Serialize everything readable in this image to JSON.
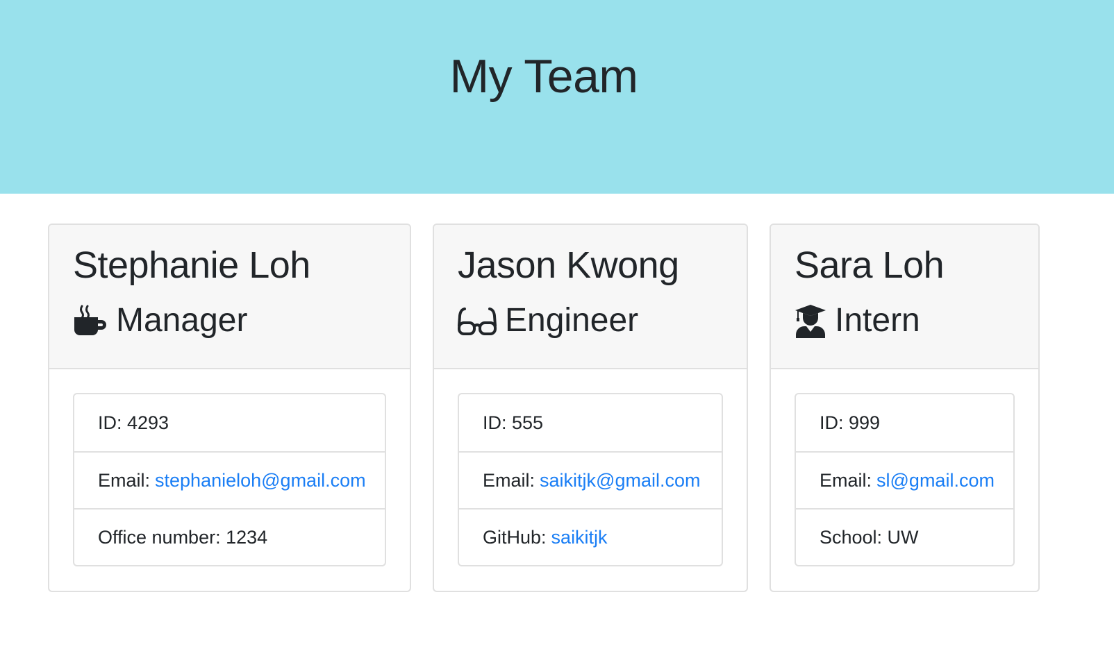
{
  "header": {
    "title": "My Team"
  },
  "team": [
    {
      "name": "Stephanie Loh",
      "role": "Manager",
      "role_icon": "coffee-mug-icon",
      "id_text": "ID: 4293",
      "email_prefix": "Email:",
      "email": "stephanieloh@gmail.com",
      "extra_text": "Office number: 1234"
    },
    {
      "name": "Jason Kwong",
      "role": "Engineer",
      "role_icon": "glasses-icon",
      "id_text": "ID: 555",
      "email_prefix": "Email:",
      "email": "saikitjk@gmail.com",
      "extra_prefix": "GitHub:",
      "extra_link": "saikitjk"
    },
    {
      "name": "Sara Loh",
      "role": "Intern",
      "role_icon": "graduate-icon",
      "id_text": "ID: 999",
      "email_prefix": "Email:",
      "email": "sl@gmail.com",
      "extra_text": "School: UW"
    }
  ],
  "colors": {
    "header_bg": "#99e1ec",
    "card_header_bg": "#f7f7f7",
    "link": "#1a7ef5",
    "text": "#212529",
    "border": "#e0e0e0"
  }
}
